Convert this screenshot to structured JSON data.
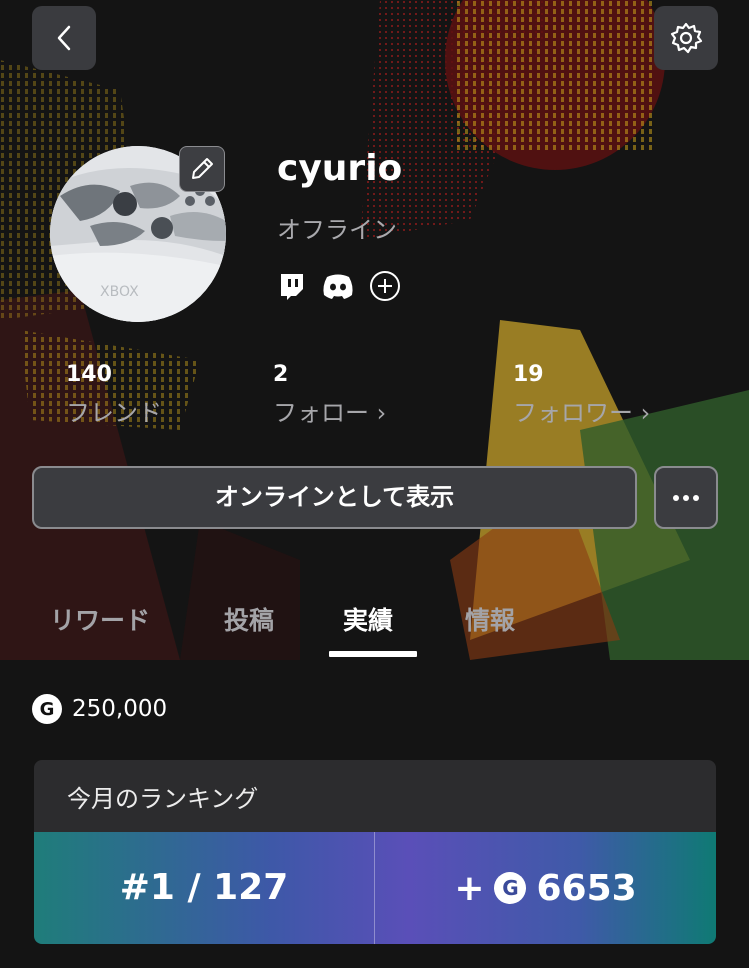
{
  "profile": {
    "username": "cyurio",
    "status": "オフライン",
    "social_icons": [
      "twitch-icon",
      "discord-icon",
      "add-circle-icon"
    ]
  },
  "stats": [
    {
      "value": "140",
      "label": "フレンド"
    },
    {
      "value": "2",
      "label": "フォロー ›"
    },
    {
      "value": "19",
      "label": "フォロワー ›"
    }
  ],
  "actions": {
    "primary_label": "オンラインとして表示",
    "more_icon": "more-dots-icon"
  },
  "tabs": [
    {
      "label": "リワード",
      "active": false
    },
    {
      "label": "投稿",
      "active": false
    },
    {
      "label": "実績",
      "active": true
    },
    {
      "label": "情報",
      "active": false
    }
  ],
  "points": {
    "badge": "G",
    "value": "250,000"
  },
  "ranking": {
    "title": "今月のランキング",
    "rank": "#1 / 127",
    "gain_prefix": "+",
    "gain_badge": "G",
    "gain_value": "6653"
  },
  "colors": {
    "background": "#141414",
    "button_bg": "#3b3c40",
    "card_gradient_start": "#1f7d7a",
    "card_gradient_mid": "#5a4fb8"
  }
}
